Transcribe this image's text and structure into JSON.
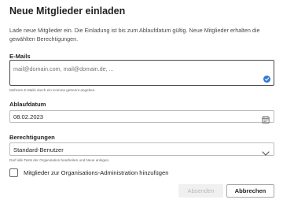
{
  "dialog": {
    "title": "Neue Mitglieder einladen",
    "description": "Lade neue Mitglieder ein. Die Einladung ist bis zum Ablaufdatum gültig. Neue Mitglieder erhalten die gewählten Berechtigungen."
  },
  "emails": {
    "label": "E-Mails",
    "placeholder": "mail@domain.com, mail@domain.de, ...",
    "hint": "Mehrere E-Mails durch ein Komma getrennt angeben.",
    "badge_icon": "checkmark-circle-icon"
  },
  "expiry": {
    "label": "Ablaufdatum",
    "value": "08.02.2023",
    "icon": "calendar-icon"
  },
  "permissions": {
    "label": "Berechtigungen",
    "selected": "Standard-Benutzer",
    "hint": "Darf alle Tests der Organisation bearbeiten und Neue anlegen.",
    "icon": "chevron-down-icon"
  },
  "org_admin": {
    "label": "Mitglieder zur Organisations-Administration hinzufügen",
    "checked": false
  },
  "actions": {
    "submit_label": "Absenden",
    "cancel_label": "Abbrechen"
  },
  "colors": {
    "accent": "#2f7ad6",
    "disabled_text": "#b9b9b9"
  }
}
